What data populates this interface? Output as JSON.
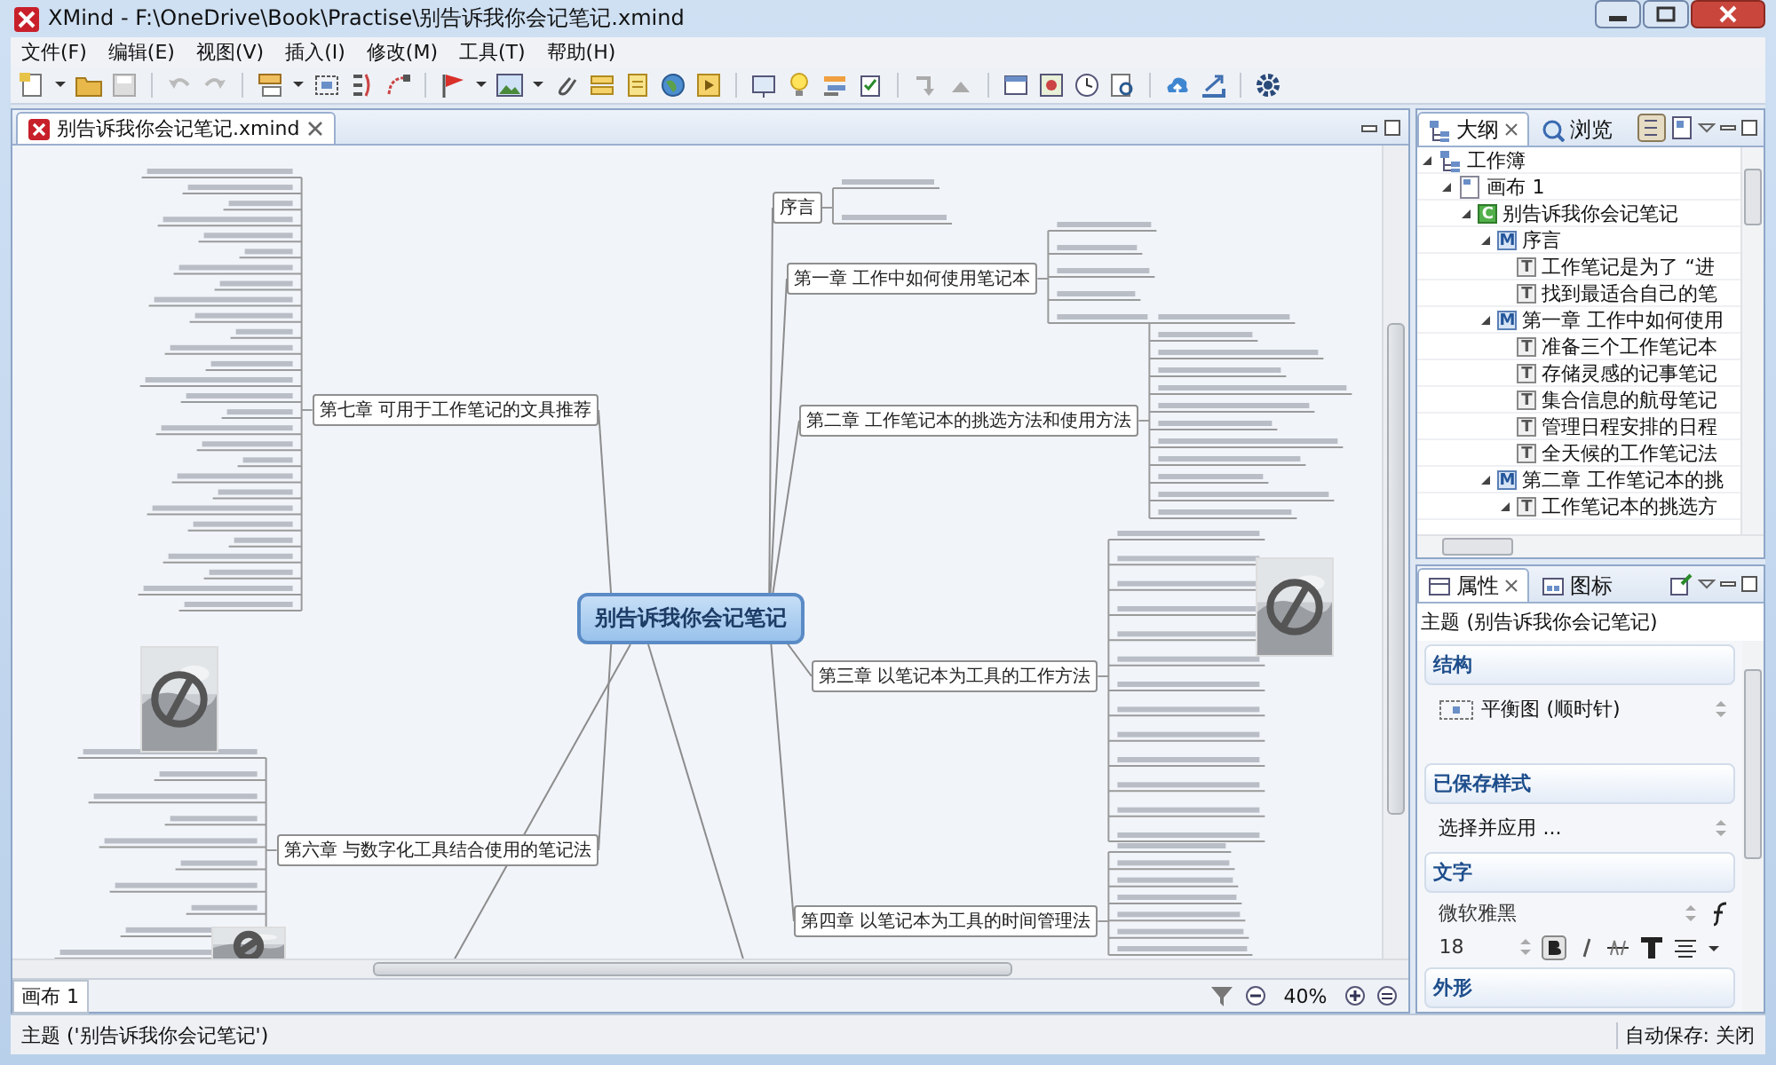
{
  "window": {
    "title": "XMind - F:\\OneDrive\\Book\\Practise\\别告诉我你会记笔记.xmind"
  },
  "menu": [
    {
      "label": "文件(F)"
    },
    {
      "label": "编辑(E)"
    },
    {
      "label": "视图(V)"
    },
    {
      "label": "插入(I)"
    },
    {
      "label": "修改(M)"
    },
    {
      "label": "工具(T)"
    },
    {
      "label": "帮助(H)"
    }
  ],
  "editor_tab": {
    "title": "别告诉我你会记笔记.xmind"
  },
  "mind_map": {
    "central": "别告诉我你会记笔记",
    "chapters": [
      {
        "title": "序言"
      },
      {
        "title": "第一章 工作中如何使用笔记本"
      },
      {
        "title": "第二章 工作笔记本的挑选方法和使用方法"
      },
      {
        "title": "第三章 以笔记本为工具的工作方法"
      },
      {
        "title": "第四章 以笔记本为工具的时间管理法"
      },
      {
        "title": "第七章 可用于工作笔记的文具推荐"
      },
      {
        "title": "第六章 与数字化工具结合使用的笔记法"
      }
    ]
  },
  "sheet_tabs": [
    {
      "label": "画布 1",
      "selected": true
    }
  ],
  "zoom": "40%",
  "outline": {
    "tabs": [
      {
        "label": "大纲",
        "selected": true
      },
      {
        "label": "浏览",
        "selected": false
      }
    ],
    "tree": [
      {
        "kind": "workbook",
        "label": "工作簿",
        "expanded": true,
        "children": [
          {
            "kind": "sheet",
            "label": "画布 1",
            "expanded": true,
            "children": [
              {
                "kind": "central",
                "badge": "C",
                "label": "别告诉我你会记笔记",
                "expanded": true,
                "children": [
                  {
                    "kind": "main",
                    "badge": "M",
                    "label": "序言",
                    "expanded": true,
                    "children": [
                      {
                        "kind": "topic",
                        "badge": "T",
                        "label": "工作笔记是为了 “进"
                      },
                      {
                        "kind": "topic",
                        "badge": "T",
                        "label": "找到最适合自己的笔"
                      }
                    ]
                  },
                  {
                    "kind": "main",
                    "badge": "M",
                    "label": "第一章 工作中如何使用",
                    "expanded": true,
                    "children": [
                      {
                        "kind": "topic",
                        "badge": "T",
                        "label": "准备三个工作笔记本"
                      },
                      {
                        "kind": "topic",
                        "badge": "T",
                        "label": "存储灵感的记事笔记"
                      },
                      {
                        "kind": "topic",
                        "badge": "T",
                        "label": "集合信息的航母笔记"
                      },
                      {
                        "kind": "topic",
                        "badge": "T",
                        "label": "管理日程安排的日程"
                      },
                      {
                        "kind": "topic",
                        "badge": "T",
                        "label": "全天候的工作笔记法"
                      }
                    ]
                  },
                  {
                    "kind": "main",
                    "badge": "M",
                    "label": "第二章 工作笔记本的挑",
                    "expanded": true,
                    "children": [
                      {
                        "kind": "topic",
                        "badge": "T",
                        "label": "工作笔记本的挑选方",
                        "expanded": true
                      }
                    ]
                  }
                ]
              }
            ]
          }
        ]
      }
    ]
  },
  "properties": {
    "tabs": [
      {
        "label": "属性",
        "selected": true
      },
      {
        "label": "图标",
        "selected": false
      }
    ],
    "subject": "主题 (别告诉我你会记笔记)",
    "sections": [
      {
        "kind": "select",
        "title": "结构",
        "value": "平衡图 (顺时针)"
      },
      {
        "kind": "select",
        "title": "已保存样式",
        "value": "选择并应用 ..."
      },
      {
        "kind": "font",
        "title": "文字",
        "font": "微软雅黑",
        "size": "18"
      },
      {
        "kind": "header",
        "title": "外形"
      }
    ]
  },
  "status_bar": {
    "text": "主题 ('别告诉我你会记笔记')",
    "autosave": "自动保存: 关闭"
  }
}
